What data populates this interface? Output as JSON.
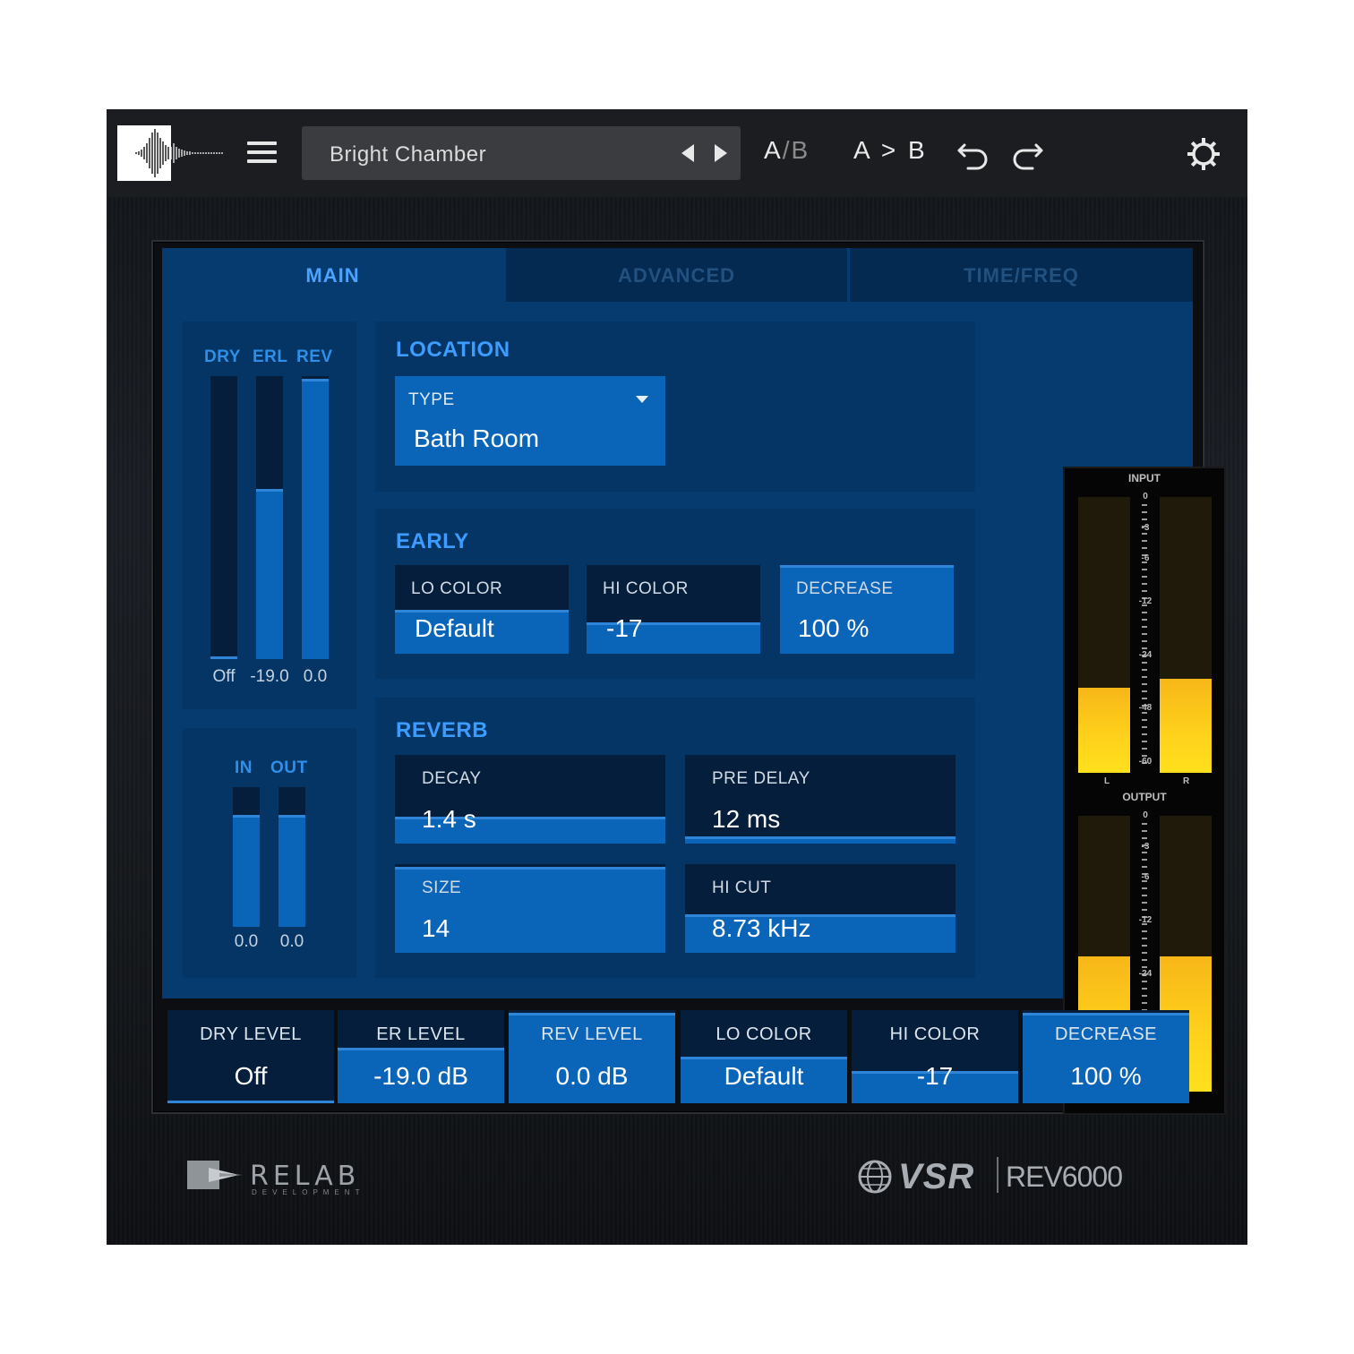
{
  "topbar": {
    "logo_icon": "waveform-logo-icon",
    "menu_icon": "hamburger-menu-icon",
    "preset_name": "Bright Chamber",
    "ab_toggle_a": "A",
    "ab_toggle_sep": "/",
    "ab_toggle_b": "B",
    "ab_copy": "A > B",
    "undo_icon": "undo-icon",
    "redo_icon": "redo-icon",
    "settings_icon": "gear-icon"
  },
  "tabs": [
    {
      "label": "MAIN",
      "active": true
    },
    {
      "label": "ADVANCED",
      "active": false
    },
    {
      "label": "TIME/FREQ",
      "active": false
    }
  ],
  "mix_meters": {
    "labels": [
      "DRY",
      "ERL",
      "REV"
    ],
    "values": [
      "Off",
      "-19.0",
      "0.0"
    ],
    "levels": [
      0.01,
      0.6,
      0.99
    ]
  },
  "io_meters": {
    "labels": [
      "IN",
      "OUT"
    ],
    "values": [
      "0.0",
      "0.0"
    ],
    "levels": [
      0.8,
      0.8
    ]
  },
  "location": {
    "title": "LOCATION",
    "type_label": "TYPE",
    "type_value": "Bath Room"
  },
  "early": {
    "title": "EARLY",
    "params": [
      {
        "label": "LO COLOR",
        "value": "Default",
        "level": 0.5
      },
      {
        "label": "HI COLOR",
        "value": "-17",
        "level": 0.35
      },
      {
        "label": "DECREASE",
        "value": "100 %",
        "level": 1.0
      }
    ]
  },
  "reverb": {
    "title": "REVERB",
    "params": [
      {
        "label": "DECAY",
        "value": "1.4 s",
        "level": 0.3
      },
      {
        "label": "PRE DELAY",
        "value": "12 ms",
        "level": 0.08
      },
      {
        "label": "SIZE",
        "value": "14",
        "level": 0.97
      },
      {
        "label": "HI CUT",
        "value": "8.73 kHz",
        "level": 0.43
      }
    ]
  },
  "level_meters": {
    "input_title": "INPUT",
    "output_title": "OUTPUT",
    "scale": [
      "0",
      "-3",
      "-6",
      "-12",
      "-24",
      "-48",
      "-60"
    ],
    "left_label": "L",
    "right_label": "R",
    "input_levels": [
      0.31,
      0.34
    ],
    "output_levels": [
      0.49,
      0.49
    ]
  },
  "bottom": [
    {
      "label": "DRY LEVEL",
      "value": "Off",
      "level": 0.03
    },
    {
      "label": "ER LEVEL",
      "value": "-19.0 dB",
      "level": 0.6
    },
    {
      "label": "REV LEVEL",
      "value": "0.0 dB",
      "level": 0.97
    },
    {
      "label": "LO COLOR",
      "value": "Default",
      "level": 0.5
    },
    {
      "label": "HI COLOR",
      "value": "-17",
      "level": 0.35
    },
    {
      "label": "DECREASE",
      "value": "100 %",
      "level": 0.97
    }
  ],
  "branding": {
    "relab": "RELAB",
    "relab_sub": "DEVELOPMENT",
    "vsr": "VSR",
    "product": "REV6000"
  },
  "colors": {
    "screen_bg": "#063b70",
    "fill_blue": "#0a64b8",
    "accent_blue": "#3c9cff",
    "meter_yellow": "#ffd21c"
  }
}
